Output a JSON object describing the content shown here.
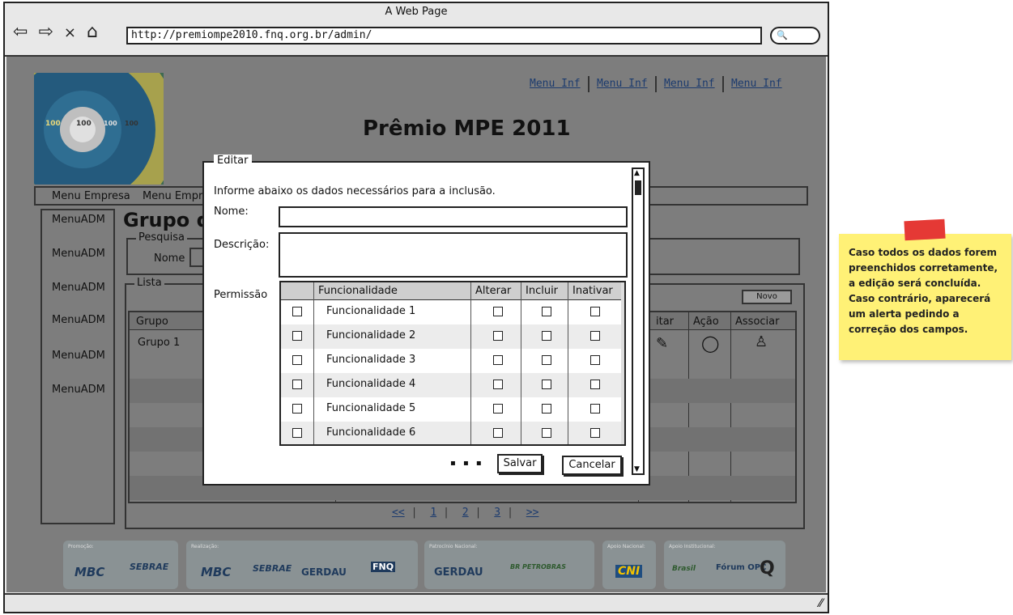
{
  "browser": {
    "title": "A Web Page",
    "url": "http://premiompe2010.fnq.org.br/admin/",
    "nav": {
      "back": "⇦",
      "forward": "⇨",
      "stop": "×",
      "home": "⌂"
    },
    "search_glyph": "🔍"
  },
  "page": {
    "site_title": "Prêmio MPE 2011",
    "top_menu": [
      "Menu Inf",
      "Menu Inf",
      "Menu Inf",
      "Menu Inf"
    ],
    "main_menu": [
      "Menu Empresa",
      "Menu Empres"
    ],
    "sidebar": [
      "MenuADM",
      "MenuADM",
      "MenuADM",
      "MenuADM",
      "MenuADM",
      "MenuADM"
    ],
    "content_title": "Grupo de",
    "search_legend": "Pesquisa",
    "search_label": "Nome",
    "list_legend": "Lista",
    "new_button": "Novo",
    "grid_headers": {
      "group": "Grupo",
      "edit": "itar",
      "action": "Ação",
      "associate": "Associar"
    },
    "grid_rows": [
      {
        "group": "Grupo 1"
      }
    ],
    "pager": {
      "first": "<<",
      "pages": [
        "1",
        "2",
        "3"
      ],
      "next": ">>"
    },
    "logo_labels": [
      "100",
      "100",
      "100",
      "100"
    ],
    "footer": {
      "groups": [
        {
          "label": "Promoção:",
          "logos": [
            "MBC",
            "SEBRAE"
          ]
        },
        {
          "label": "Realização:",
          "logos": [
            "MBC",
            "SEBRAE",
            "GERDAU",
            "FNQ"
          ]
        },
        {
          "label": "Patrocínio Nacional:",
          "logos": [
            "GERDAU",
            "BR PETROBRAS"
          ]
        },
        {
          "label": "Apoio Nacional:",
          "logos": [
            "CNI"
          ]
        },
        {
          "label": "Apoio Institucional:",
          "logos": [
            "Brasil",
            "Fórum OPC",
            "Q"
          ]
        }
      ]
    }
  },
  "dialog": {
    "legend": "Editar",
    "intro": "Informe abaixo os dados necessários para a inclusão.",
    "name_label": "Nome:",
    "name_value": "",
    "description_label": "Descrição:",
    "description_value": "",
    "permission_label": "Permissão",
    "table_headers": {
      "feature": "Funcionalidade",
      "edit": "Alterar",
      "include": "Incluir",
      "deactivate": "Inativar"
    },
    "rows": [
      {
        "feature": "Funcionalidade 1"
      },
      {
        "feature": "Funcionalidade 2"
      },
      {
        "feature": "Funcionalidade 3"
      },
      {
        "feature": "Funcionalidade 4"
      },
      {
        "feature": "Funcionalidade 5"
      },
      {
        "feature": "Funcionalidade 6"
      }
    ],
    "save_button": "Salvar",
    "cancel_button": "Cancelar"
  },
  "sticky_note": {
    "text": "Caso todos os dados forem preenchidos corretamente, a edição será concluída. Caso contrário, aparecerá um alerta pedindo a correção dos campos."
  },
  "colors": {
    "note": "#fff176",
    "tape": "#e53935",
    "link": "#1c3b6e",
    "overlay": "#7d7d7d"
  }
}
